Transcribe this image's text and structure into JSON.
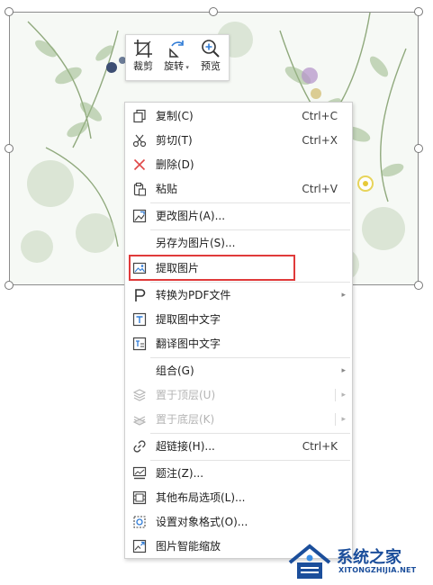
{
  "mini_toolbar": {
    "crop": "裁剪",
    "rotate": "旋转",
    "preview": "预览"
  },
  "context_menu": {
    "items": [
      {
        "label": "复制(C)",
        "shortcut": "Ctrl+C",
        "icon": "copy-icon"
      },
      {
        "label": "剪切(T)",
        "shortcut": "Ctrl+X",
        "icon": "scissors-icon"
      },
      {
        "label": "删除(D)",
        "icon": "delete-x-icon"
      },
      {
        "label": "粘贴",
        "shortcut": "Ctrl+V",
        "icon": "paste-icon"
      },
      {
        "label": "更改图片(A)...",
        "icon": "change-picture-icon"
      },
      {
        "label": "另存为图片(S)..."
      },
      {
        "label": "提取图片",
        "icon": "extract-picture-icon",
        "highlighted": true
      },
      {
        "label": "转换为PDF文件",
        "icon": "pdf-convert-icon",
        "submenu": true
      },
      {
        "label": "提取图中文字",
        "icon": "ocr-icon"
      },
      {
        "label": "翻译图中文字",
        "icon": "translate-icon"
      },
      {
        "label": "组合(G)",
        "submenu": true
      },
      {
        "label": "置于顶层(U)",
        "icon": "bring-to-front-icon",
        "disabled": true,
        "submenu": true
      },
      {
        "label": "置于底层(K)",
        "icon": "send-to-back-icon",
        "disabled": true,
        "submenu": true
      },
      {
        "label": "超链接(H)...",
        "shortcut": "Ctrl+K",
        "icon": "hyperlink-icon"
      },
      {
        "label": "题注(Z)...",
        "icon": "caption-icon"
      },
      {
        "label": "其他布局选项(L)...",
        "icon": "layout-options-icon"
      },
      {
        "label": "设置对象格式(O)...",
        "icon": "format-object-icon"
      },
      {
        "label": "图片智能缩放",
        "icon": "smart-zoom-icon"
      }
    ]
  },
  "colors": {
    "highlight_border": "#e03a3a",
    "watermark_blue": "#1b4e9b"
  },
  "watermark": {
    "title": "系统之家",
    "subtitle": "XITONGZHIJIA.NET"
  }
}
